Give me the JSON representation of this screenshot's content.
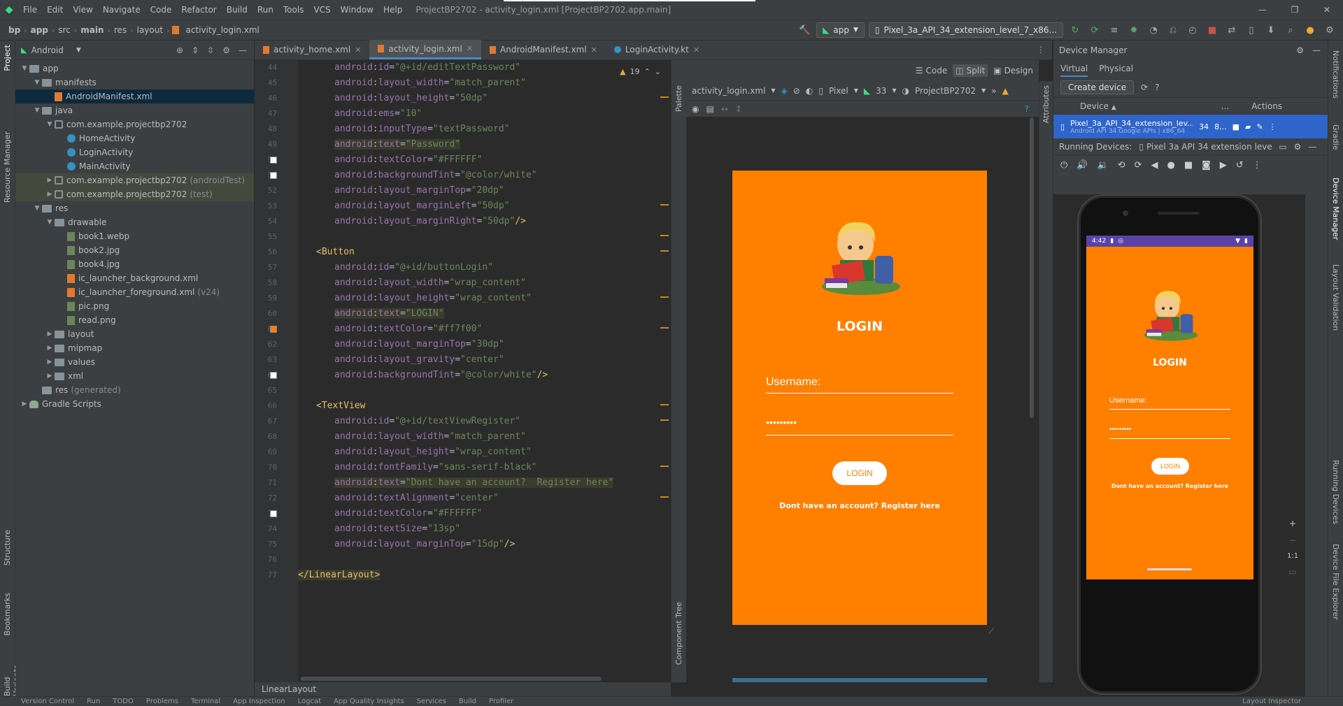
{
  "menubar": {
    "items": [
      "File",
      "Edit",
      "View",
      "Navigate",
      "Code",
      "Refactor",
      "Build",
      "Run",
      "Tools",
      "VCS",
      "Window",
      "Help"
    ],
    "title": "ProjectBP2702 - activity_login.xml [ProjectBP2702.app.main]"
  },
  "navbar": {
    "crumbs": [
      "bp",
      "app",
      "src",
      "main",
      "res",
      "layout",
      "activity_login.xml"
    ],
    "run_config": "app",
    "device": "Pixel_3a_API_34_extension_level_7_x86..."
  },
  "project": {
    "view_mode": "Android",
    "tree": [
      {
        "label": "app",
        "level": 0,
        "icon": "folder",
        "open": true
      },
      {
        "label": "manifests",
        "level": 1,
        "icon": "folder",
        "open": true
      },
      {
        "label": "AndroidManifest.xml",
        "level": 2,
        "icon": "xml",
        "selected": true
      },
      {
        "label": "java",
        "level": 1,
        "icon": "folder",
        "open": true
      },
      {
        "label": "com.example.projectbp2702",
        "level": 2,
        "icon": "pkg",
        "open": true
      },
      {
        "label": "HomeActivity",
        "level": 3,
        "icon": "kt"
      },
      {
        "label": "LoginActivity",
        "level": 3,
        "icon": "kt"
      },
      {
        "label": "MainActivity",
        "level": 3,
        "icon": "kt"
      },
      {
        "label": "com.example.projectbp2702",
        "suffix": "(androidTest)",
        "level": 2,
        "icon": "pkg",
        "closed": true,
        "hl": true
      },
      {
        "label": "com.example.projectbp2702",
        "suffix": "(test)",
        "level": 2,
        "icon": "pkg",
        "closed": true,
        "hl": true
      },
      {
        "label": "res",
        "level": 1,
        "icon": "folder",
        "open": true
      },
      {
        "label": "drawable",
        "level": 2,
        "icon": "folder",
        "open": true
      },
      {
        "label": "book1.webp",
        "level": 3,
        "icon": "img"
      },
      {
        "label": "book2.jpg",
        "level": 3,
        "icon": "img"
      },
      {
        "label": "book4.jpg",
        "level": 3,
        "icon": "img"
      },
      {
        "label": "ic_launcher_background.xml",
        "level": 3,
        "icon": "xml"
      },
      {
        "label": "ic_launcher_foreground.xml",
        "suffix": "(v24)",
        "level": 3,
        "icon": "xml"
      },
      {
        "label": "pic.png",
        "level": 3,
        "icon": "img"
      },
      {
        "label": "read.png",
        "level": 3,
        "icon": "img"
      },
      {
        "label": "layout",
        "level": 2,
        "icon": "folder",
        "closed": true
      },
      {
        "label": "mipmap",
        "level": 2,
        "icon": "folder",
        "closed": true
      },
      {
        "label": "values",
        "level": 2,
        "icon": "folder",
        "closed": true
      },
      {
        "label": "xml",
        "level": 2,
        "icon": "folder",
        "closed": true
      },
      {
        "label": "res",
        "suffix": "(generated)",
        "level": 1,
        "icon": "folder"
      },
      {
        "label": "Gradle Scripts",
        "level": 0,
        "icon": "gradle",
        "closed": true
      }
    ]
  },
  "left_strip": {
    "project": "Project",
    "resource_manager": "Resource Manager",
    "structure": "Structure",
    "bookmarks": "Bookmarks",
    "build_variants": "Build Variants"
  },
  "tabs": [
    "activity_home.xml",
    "activity_login.xml",
    "AndroidManifest.xml",
    "LoginActivity.kt"
  ],
  "editor": {
    "warning_count": "19",
    "line_numbers": [
      "44",
      "45",
      "46",
      "47",
      "48",
      "49",
      "50",
      "51",
      "52",
      "53",
      "54",
      "55",
      "56",
      "57",
      "58",
      "59",
      "60",
      "61",
      "62",
      "63",
      "64",
      "65",
      "66",
      "67",
      "68",
      "69",
      "70",
      "71",
      "72",
      "73",
      "74",
      "75",
      "76",
      "77"
    ],
    "lines": [
      {
        "i": 2,
        "a": "id",
        "v": "\"@+id/editTextPassword\""
      },
      {
        "i": 2,
        "a": "layout_width",
        "v": "\"match_parent\""
      },
      {
        "i": 2,
        "a": "layout_height",
        "v": "\"50dp\""
      },
      {
        "i": 2,
        "a": "ems",
        "v": "\"10\""
      },
      {
        "i": 2,
        "a": "inputType",
        "v": "\"textPassword\""
      },
      {
        "i": 2,
        "a": "text",
        "v": "\"Password\"",
        "hl": true
      },
      {
        "i": 2,
        "a": "textColor",
        "v": "\"#FFFFFF\"",
        "sw": "#ffffff"
      },
      {
        "i": 2,
        "a": "backgroundTint",
        "v": "\"@color/white\"",
        "sw": "#ffffff"
      },
      {
        "i": 2,
        "a": "layout_marginTop",
        "v": "\"20dp\""
      },
      {
        "i": 2,
        "a": "layout_marginLeft",
        "v": "\"50dp\""
      },
      {
        "i": 2,
        "a": "layout_marginRight",
        "v": "\"50dp\"",
        "end": "/>"
      },
      {
        "i": 0,
        "raw": ""
      },
      {
        "i": 1,
        "tag": "<Button"
      },
      {
        "i": 2,
        "a": "id",
        "v": "\"@+id/buttonLogin\""
      },
      {
        "i": 2,
        "a": "layout_width",
        "v": "\"wrap_content\""
      },
      {
        "i": 2,
        "a": "layout_height",
        "v": "\"wrap_content\""
      },
      {
        "i": 2,
        "a": "text",
        "v": "\"LOGIN\"",
        "hl": true
      },
      {
        "i": 2,
        "a": "textColor",
        "v": "\"#ff7f00\"",
        "sw": "#ff7f00"
      },
      {
        "i": 2,
        "a": "layout_marginTop",
        "v": "\"30dp\""
      },
      {
        "i": 2,
        "a": "layout_gravity",
        "v": "\"center\""
      },
      {
        "i": 2,
        "a": "backgroundTint",
        "v": "\"@color/white\"",
        "end": "/>",
        "sw": "#ffffff"
      },
      {
        "i": 0,
        "raw": ""
      },
      {
        "i": 1,
        "tag": "<TextView"
      },
      {
        "i": 2,
        "a": "id",
        "v": "\"@+id/textViewRegister\""
      },
      {
        "i": 2,
        "a": "layout_width",
        "v": "\"match_parent\""
      },
      {
        "i": 2,
        "a": "layout_height",
        "v": "\"wrap_content\""
      },
      {
        "i": 2,
        "a": "fontFamily",
        "v": "\"sans-serif-black\""
      },
      {
        "i": 2,
        "a": "text",
        "v": "\"Dont have an account?  Register here\"",
        "hl": true
      },
      {
        "i": 2,
        "a": "textAlignment",
        "v": "\"center\""
      },
      {
        "i": 2,
        "a": "textColor",
        "v": "\"#FFFFFF\"",
        "sw": "#ffffff"
      },
      {
        "i": 2,
        "a": "textSize",
        "v": "\"13sp\""
      },
      {
        "i": 2,
        "a": "layout_marginTop",
        "v": "\"15dp\"",
        "end": "/>"
      },
      {
        "i": 0,
        "raw": ""
      },
      {
        "i": 0,
        "tag": "</LinearLayout>",
        "hl": true
      }
    ],
    "breadcrumb": "LinearLayout"
  },
  "design": {
    "modes": {
      "code": "Code",
      "split": "Split",
      "design": "Design"
    },
    "file": "activity_login.xml",
    "device": "Pixel",
    "api": "33",
    "theme": "ProjectBP2702",
    "palette": "Palette",
    "component_tree": "Component Tree",
    "attributes": "Attributes"
  },
  "app_screen": {
    "title": "LOGIN",
    "username": "Username:",
    "password": "•••••••••",
    "button": "LOGIN",
    "register": "Dont have an account?  Register here",
    "colors": {
      "bg": "#ff7f00",
      "text": "#ffffff"
    }
  },
  "device_manager": {
    "title": "Device Manager",
    "tabs": [
      "Virtual",
      "Physical"
    ],
    "create": "Create device",
    "col_device": "Device",
    "col_dots": "...",
    "col_actions": "Actions",
    "device_name": "Pixel_3a_API_34_extension_lev...",
    "device_sub": "Android API 34 Google APIs | x86_64",
    "api": "34",
    "size": "8...",
    "running_label": "Running Devices:",
    "running_device": "Pixel 3a API 34 extension level 7 x",
    "emu_time": "4:42",
    "zoom": "1:1"
  },
  "right_strip": {
    "notifications": "Notifications",
    "gradle": "Gradle",
    "device_manager": "Device Manager",
    "layout_validation": "Layout Validation",
    "running_devices": "Running Devices",
    "device_file_explorer": "Device File Explorer"
  },
  "statusbar": [
    "Version Control",
    "Run",
    "TODO",
    "Problems",
    "Terminal",
    "App Inspection",
    "Logcat",
    "App Quality Insights",
    "Services",
    "Build",
    "Profiler",
    "Layout Inspector"
  ]
}
